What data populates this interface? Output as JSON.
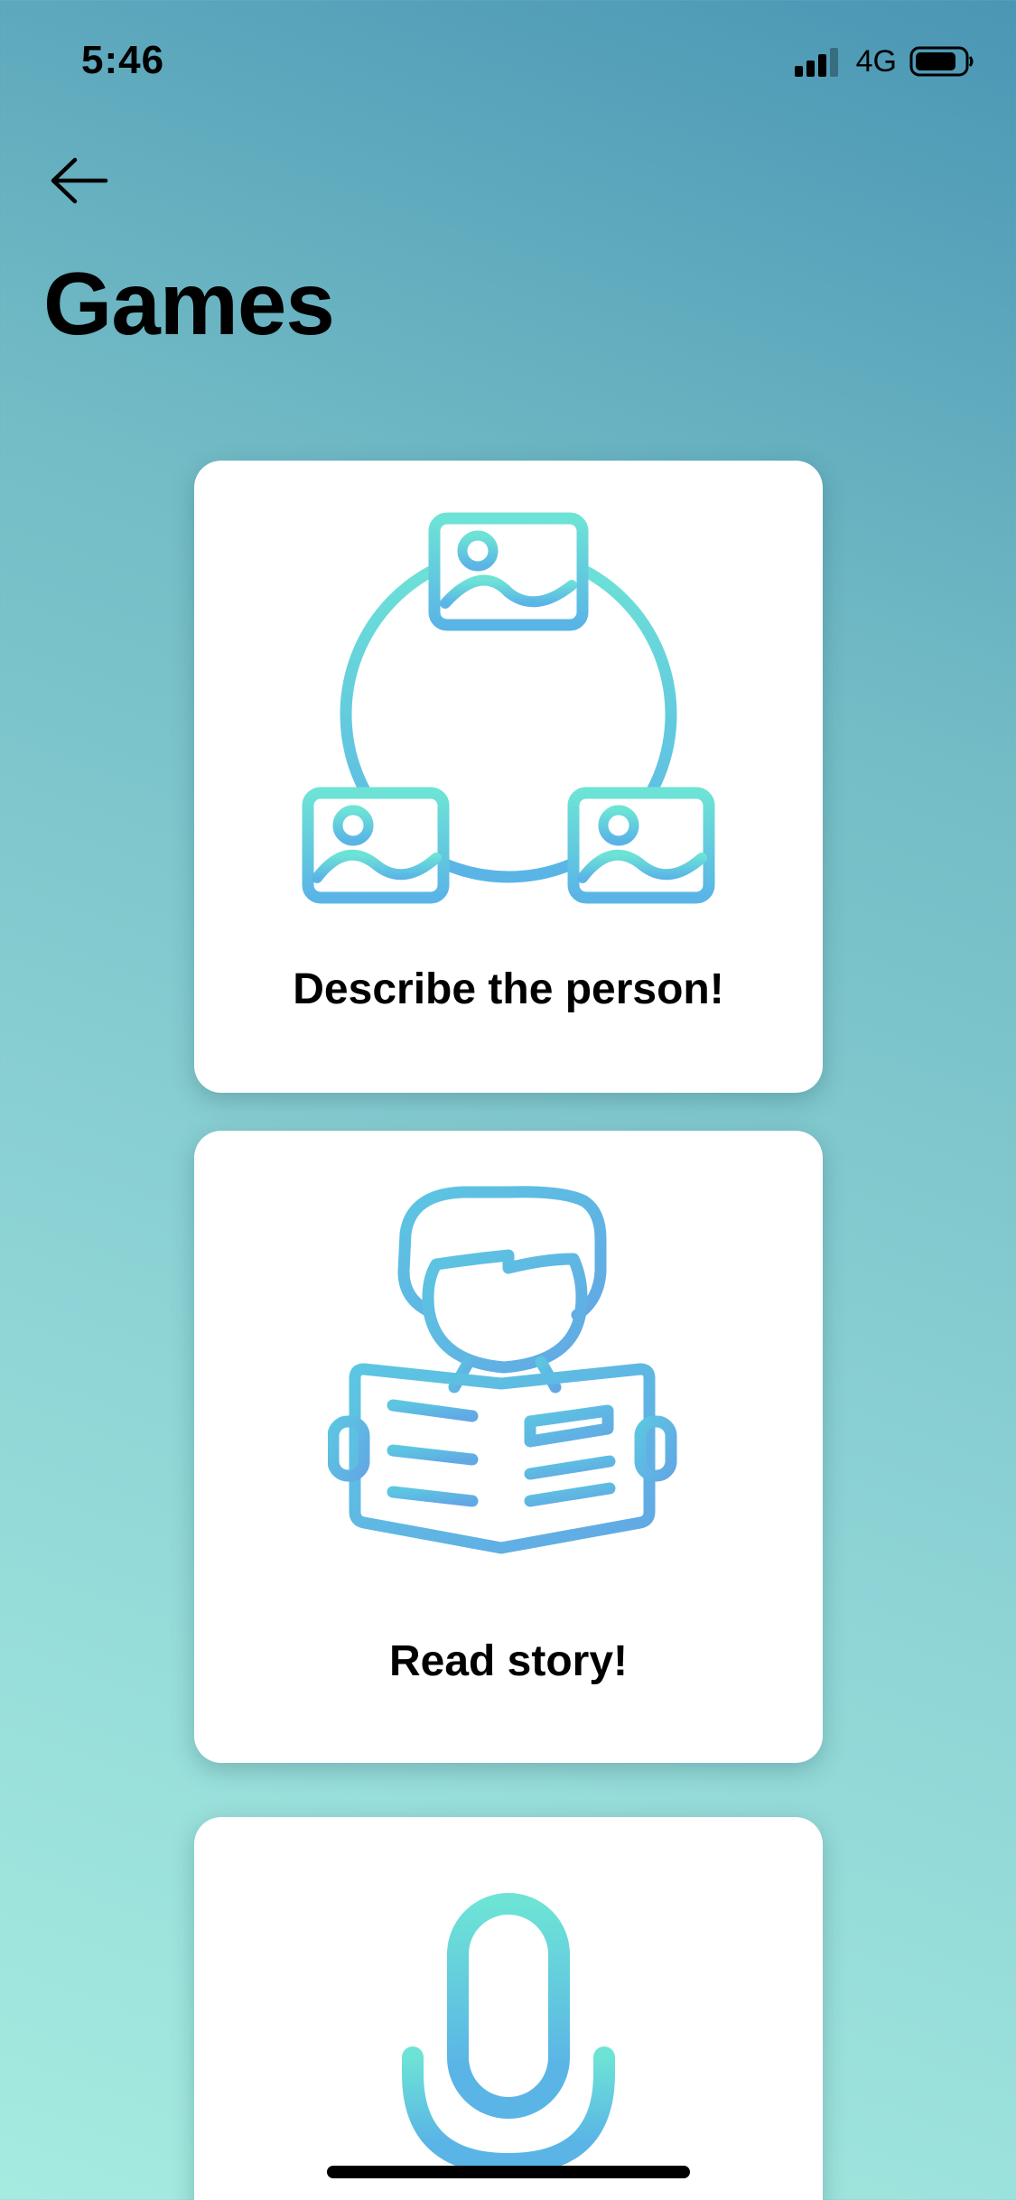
{
  "status_bar": {
    "time": "5:46",
    "network": "4G"
  },
  "header": {
    "back_icon": "arrow-left-icon",
    "title": "Games"
  },
  "games": [
    {
      "label": "Describe the person!",
      "icon": "image-network-icon"
    },
    {
      "label": "Read story!",
      "icon": "person-reading-icon"
    },
    {
      "label": "",
      "icon": "microphone-icon"
    }
  ],
  "colors": {
    "gradient_top": "#4a96b4",
    "gradient_bottom": "#a6ebe0",
    "icon_teal": "#6de3d6",
    "icon_blue": "#5ab4e6",
    "card_bg": "#ffffff"
  }
}
